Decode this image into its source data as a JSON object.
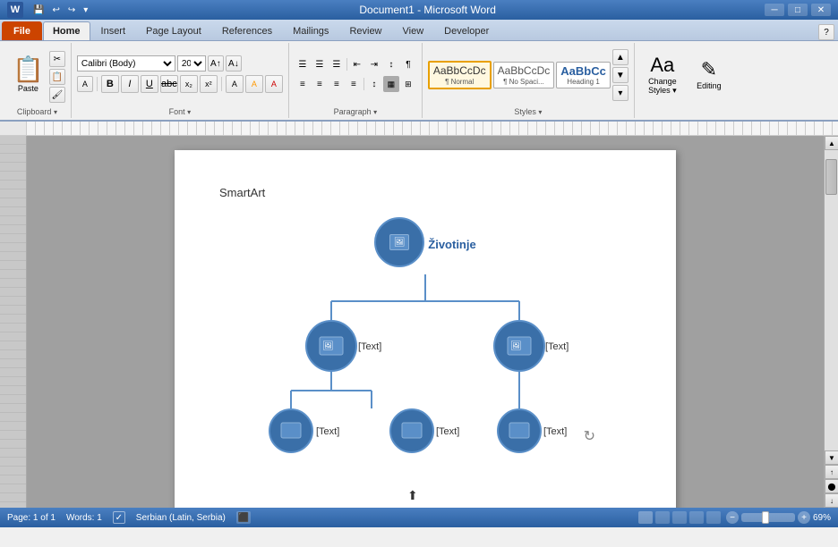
{
  "titlebar": {
    "title": "Document1 - Microsoft Word",
    "minimize": "─",
    "maximize": "□",
    "close": "✕"
  },
  "qat": {
    "items": [
      "💾",
      "↩",
      "↪",
      "🖨"
    ]
  },
  "tabs": [
    {
      "label": "File",
      "type": "file"
    },
    {
      "label": "Home",
      "type": "tab",
      "active": true
    },
    {
      "label": "Insert",
      "type": "tab"
    },
    {
      "label": "Page Layout",
      "type": "tab"
    },
    {
      "label": "References",
      "type": "tab"
    },
    {
      "label": "Mailings",
      "type": "tab"
    },
    {
      "label": "Review",
      "type": "tab"
    },
    {
      "label": "View",
      "type": "tab"
    },
    {
      "label": "Developer",
      "type": "tab"
    }
  ],
  "ribbon": {
    "groups": [
      {
        "label": "Clipboard"
      },
      {
        "label": "Font"
      },
      {
        "label": "Paragraph"
      },
      {
        "label": "Styles"
      },
      {
        "label": ""
      }
    ],
    "clipboard": {
      "paste": "Paste",
      "cut": "✂",
      "copy": "📋",
      "painter": "🖌"
    },
    "font": {
      "family": "Calibri (Body)",
      "size": "20",
      "bold": "B",
      "italic": "I",
      "underline": "U",
      "strikethrough": "abc",
      "subscript": "x₂",
      "superscript": "x²",
      "font_color": "A",
      "highlight": "A"
    },
    "paragraph": {
      "bullets": "☰",
      "numbering": "☰",
      "indent_dec": "←",
      "indent_inc": "→"
    },
    "styles": [
      {
        "label": "¶ Normal",
        "preview": "AaBbCcDc",
        "active": true
      },
      {
        "label": "¶ No Spaci...",
        "preview": "AaBbCcDc"
      },
      {
        "label": "Heading 1",
        "preview": "AaBbCc"
      }
    ],
    "change_styles": "Change\nStyles",
    "editing": "Editing"
  },
  "document": {
    "smartart_label": "SmartArt",
    "root_node": {
      "text": "Životinje",
      "has_icon": true
    },
    "level2": [
      {
        "text": "[Text]",
        "has_icon": true
      },
      {
        "text": "[Text]",
        "has_icon": true
      }
    ],
    "level3": [
      {
        "text": "[Text]",
        "has_icon": true
      },
      {
        "text": "[Text]",
        "has_icon": true
      },
      {
        "text": "[Text]",
        "has_icon": true
      }
    ]
  },
  "statusbar": {
    "page": "Page: 1 of 1",
    "words": "Words: 1",
    "language": "Serbian (Latin, Serbia)",
    "zoom": "69%",
    "zoom_minus": "−",
    "zoom_plus": "+"
  }
}
